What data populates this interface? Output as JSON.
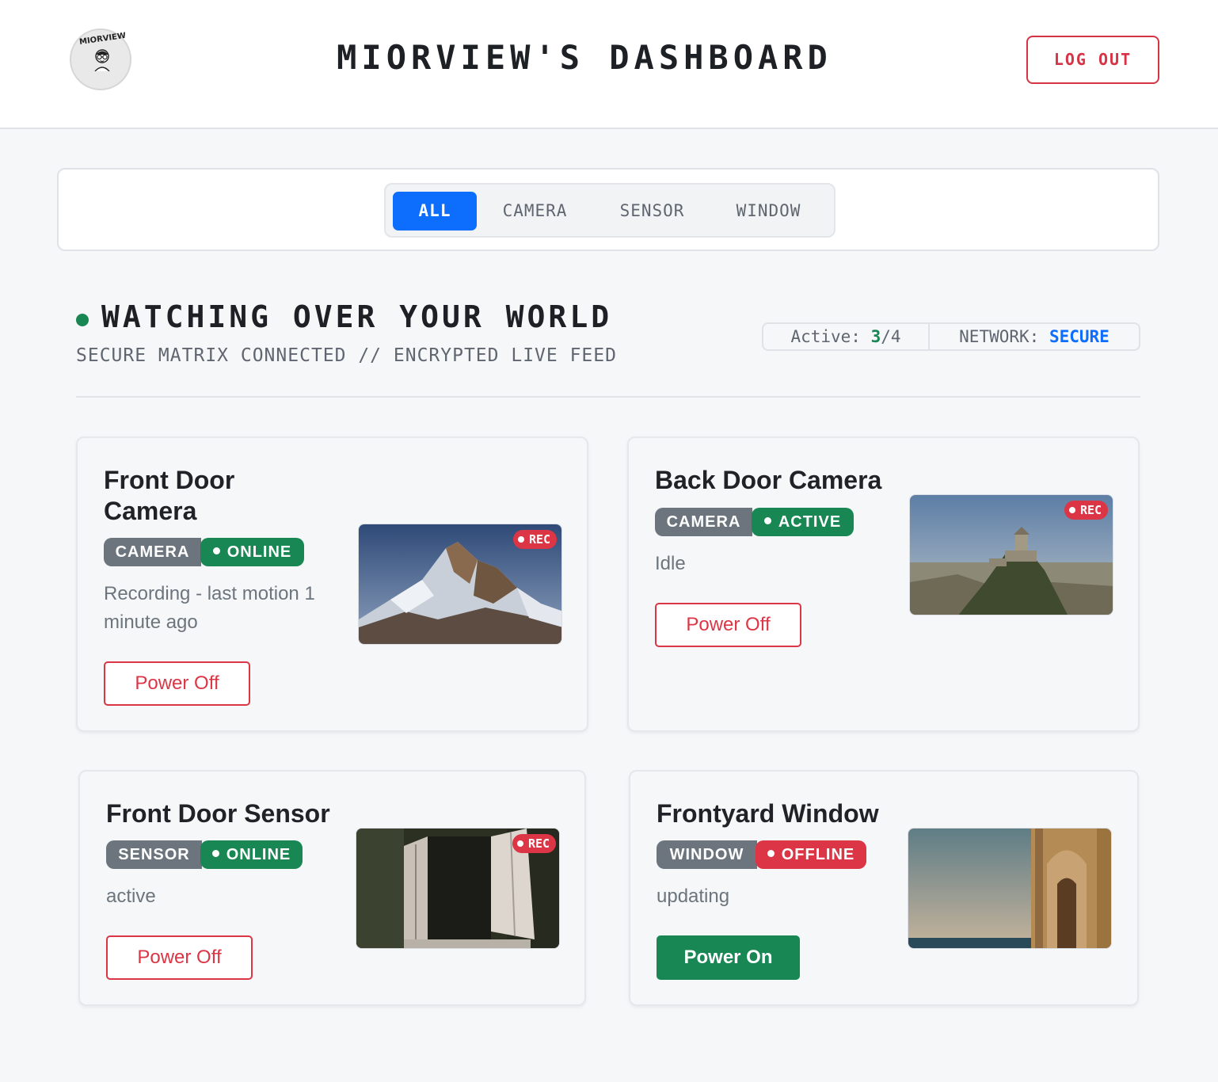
{
  "header": {
    "logo_text": "MIORVIEW",
    "title": "MIORVIEW'S DASHBOARD",
    "logout_label": "LOG OUT"
  },
  "filters": {
    "tabs": [
      {
        "label": "ALL",
        "active": true
      },
      {
        "label": "CAMERA",
        "active": false
      },
      {
        "label": "SENSOR",
        "active": false
      },
      {
        "label": "WINDOW",
        "active": false
      }
    ]
  },
  "hero": {
    "title": "WATCHING OVER YOUR WORLD",
    "subtitle": "SECURE MATRIX CONNECTED // ENCRYPTED LIVE FEED",
    "active_label": "Active:",
    "active_count": "3",
    "active_total": "/4",
    "network_label": "NETWORK:",
    "network_status": "SECURE"
  },
  "devices": [
    {
      "name": "Front Door Camera",
      "name_line1": "Front Door",
      "name_line2": "Camera",
      "type": "CAMERA",
      "status": "ONLINE",
      "status_color": "#198754",
      "detail": "Recording - last motion 1 minute ago",
      "detail_line1": "Recording - last motion 1",
      "detail_line2": "minute ago",
      "button": "Power Off",
      "rec": "REC",
      "thumbnail": "mountain"
    },
    {
      "name": "Back Door Camera",
      "type": "CAMERA",
      "status": "ACTIVE",
      "status_color": "#198754",
      "detail": "Idle",
      "button": "Power Off",
      "rec": "REC",
      "thumbnail": "castle-on-cliff"
    },
    {
      "name": "Front Door Sensor",
      "type": "SENSOR",
      "status": "ONLINE",
      "status_color": "#198754",
      "detail": "active",
      "button": "Power Off",
      "rec": "REC",
      "thumbnail": "open-window-shutters"
    },
    {
      "name": "Frontyard Window",
      "type": "WINDOW",
      "status": "OFFLINE",
      "status_color": "#dc3545",
      "detail": "updating",
      "button": "Power On",
      "thumbnail": "sea-and-arched-doorway"
    }
  ],
  "colors": {
    "primary": "#0d6efd",
    "success": "#198754",
    "danger": "#dc3545",
    "secondary": "#6c757d"
  }
}
